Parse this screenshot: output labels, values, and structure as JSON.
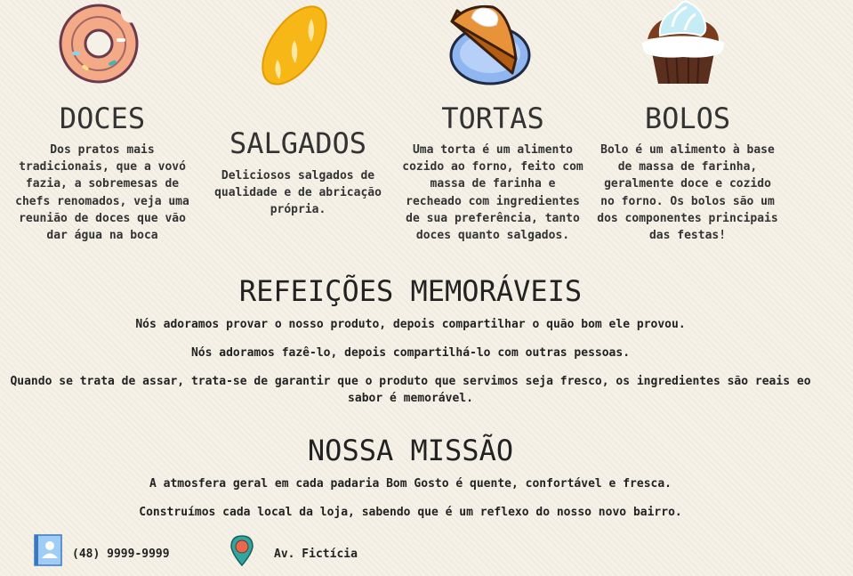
{
  "categories": [
    {
      "title": "DOCES",
      "description": "Dos pratos mais tradicionais, que a vovó fazia, a sobremesas de chefs renomados, veja uma reunião de doces que vão dar água na boca",
      "icon": "donut-icon"
    },
    {
      "title": "SALGADOS",
      "description": "Deliciosos salgados de qualidade e de abricação própria.",
      "icon": "bread-icon"
    },
    {
      "title": "TORTAS",
      "description": "Uma torta é um alimento cozido ao forno, feito com massa de farinha e recheado com ingredientes de sua preferência, tanto doces quanto salgados.",
      "icon": "pie-icon"
    },
    {
      "title": "BOLOS",
      "description": "Bolo é um alimento à base de massa de farinha, geralmente doce e cozido no forno. Os bolos são um dos componentes principais das festas!",
      "icon": "cupcake-icon"
    }
  ],
  "memorable": {
    "title": "REFEIÇÕES MEMORÁVEIS",
    "paragraphs": [
      "Nós adoramos provar o nosso produto, depois compartilhar o quão bom ele provou.",
      "Nós adoramos fazê-lo, depois compartilhá-lo com outras pessoas.",
      "Quando se trata de assar, trata-se de garantir que o produto que servimos seja fresco, os ingredientes são reais eo sabor é memorável."
    ]
  },
  "mission": {
    "title": "NOSSA MISSÃO",
    "paragraphs": [
      "A atmosfera geral em cada padaria Bom Gosto é quente, confortável e fresca.",
      "Construímos cada local da loja, sabendo que é um reflexo do nosso novo bairro."
    ]
  },
  "contact": {
    "phone": "(48) 9999-9999",
    "address": "Av. Fictícia",
    "phone_icon": "contact-card-icon",
    "address_icon": "map-pin-icon"
  },
  "colors": {
    "background": "#f5f1e6",
    "text": "#2b2b2b",
    "donut": "#f4a987",
    "bread": "#f7b716",
    "pie_plate": "#8fb6f0",
    "cupcake_cream": "#c6ecf6",
    "cupcake_base": "#5a2f1e"
  }
}
